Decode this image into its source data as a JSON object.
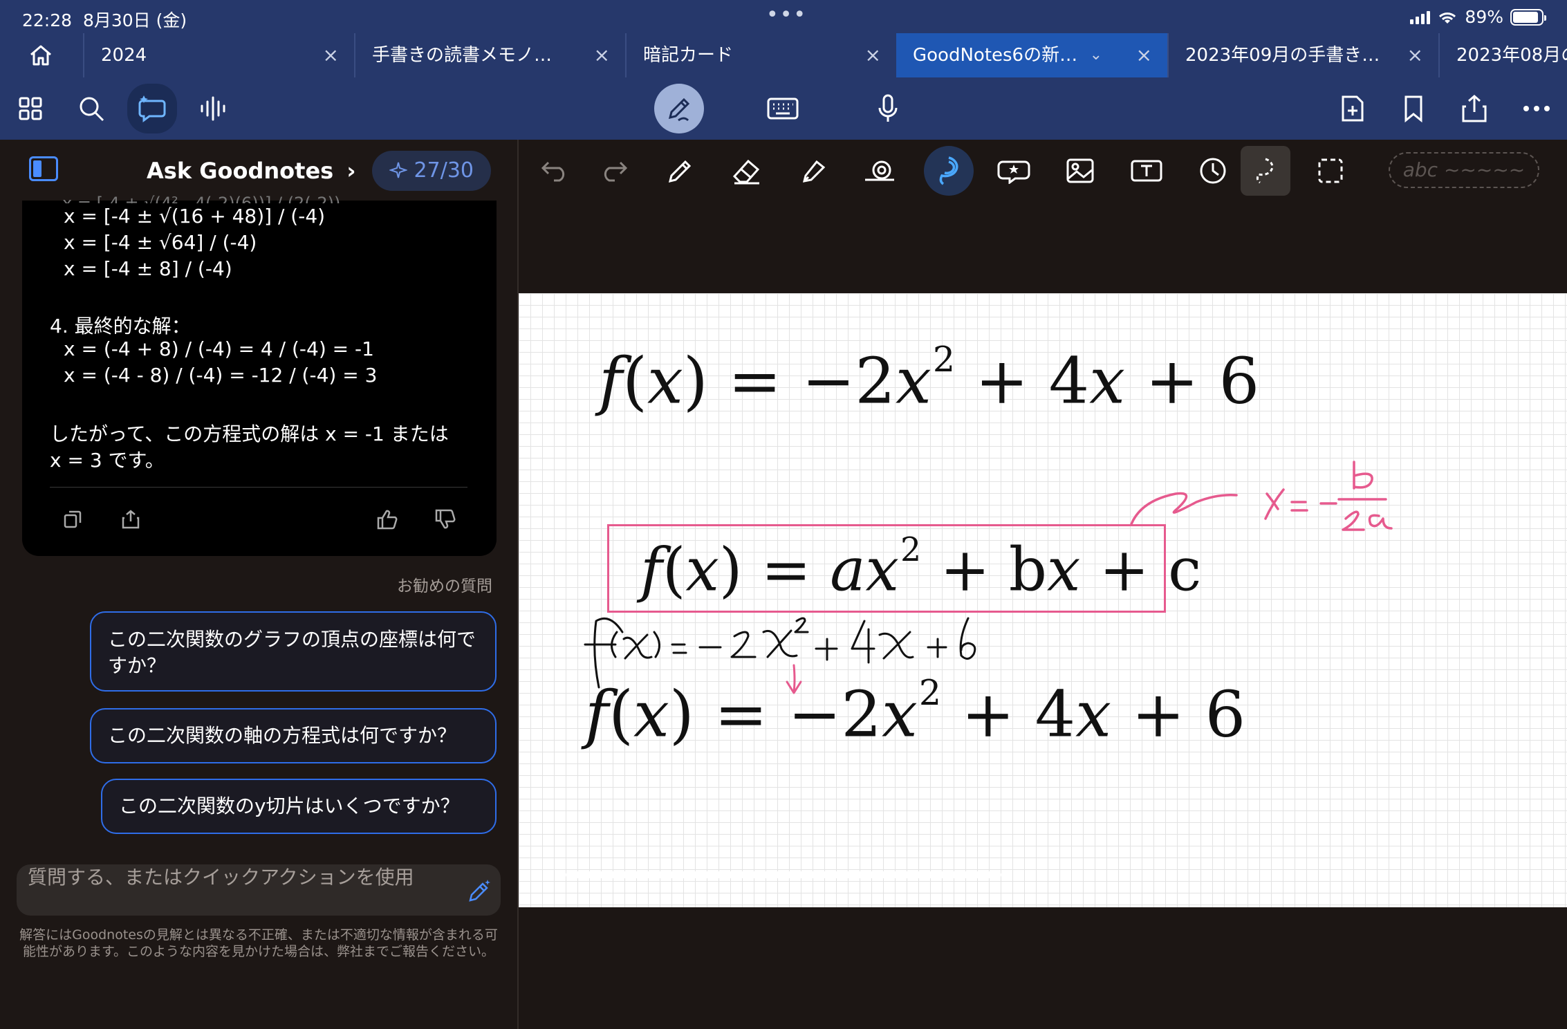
{
  "status_bar": {
    "time": "22:28",
    "date": "8月30日 (金)",
    "dots": "•••",
    "battery": "89%",
    "battery_level": 0.89
  },
  "tabs": [
    {
      "label": "2024",
      "close": "×"
    },
    {
      "label": "手書きの読書メモノ…",
      "close": "×"
    },
    {
      "label": "暗記カード",
      "close": "×"
    },
    {
      "label": "GoodNotes6の新…",
      "close": "×",
      "active": true
    },
    {
      "label": "2023年09月の手書き…",
      "close": "×"
    },
    {
      "label": "2023年08月の",
      "close": ""
    }
  ],
  "toolbar": {
    "left": [
      "grid-icon",
      "search-icon",
      "ask-goodnotes-icon",
      "audio-waveform-icon"
    ],
    "center": [
      "pen-mode-icon",
      "keyboard-icon",
      "microphone-icon"
    ],
    "right": [
      "add-page-icon",
      "bookmark-icon",
      "share-icon",
      "more-icon"
    ]
  },
  "sidebar": {
    "title": "Ask Goodnotes",
    "chevron": "›",
    "credits": "27/30",
    "answer_lines": [
      "x = [-4 ± √(16 + 48)] / (-4)",
      "x = [-4 ± √64] / (-4)",
      "x = [-4 ± 8] / (-4)",
      "4. 最終的な解：",
      "x = (-4 + 8) / (-4) = 4 / (-4) = -1",
      "x = (-4 - 8) / (-4) = -12 / (-4) = 3",
      "したがって、この方程式の解は x = -1 または",
      "x = 3 です。"
    ],
    "recommended_label": "お勧めの質問",
    "suggestions": [
      "この二次関数のグラフの頂点の座標は何ですか？",
      "この二次関数の軸の方程式は何ですか？",
      "この二次関数のy切片はいくつですか？"
    ],
    "input_placeholder": "質問する、またはクイックアクションを使用",
    "disclaimer": "解答にはGoodnotesの見解とは異なる不正確、または不適切な情報が含まれる可能性があります。このような内容を見かけた場合は、弊社までご報告ください。"
  },
  "canvas_tools": {
    "items": [
      "undo-icon",
      "redo-icon",
      "pen-icon",
      "eraser-icon",
      "highlighter-icon",
      "shape-icon",
      "lasso-icon",
      "sticker-icon",
      "image-icon",
      "text-box-icon",
      "clock-icon",
      "lasso-select-icon",
      "select-rect-icon"
    ],
    "handwriting_placeholder": "abc ~~~~~"
  },
  "page": {
    "eq1": {
      "lhs": "f",
      "x": "x",
      "rhs_a": "−2",
      "exp": "2",
      "rhs_b": "+ 4",
      "rhs_c": "+ 6"
    },
    "eq2": {
      "lhs": "f",
      "x": "x",
      "a": "a",
      "exp": "2",
      "b": "+ b",
      "c": "+ c"
    },
    "handwritten_eq": "f(x) = -2x² + 4x + 6",
    "handwritten_note": "x = - b/2a",
    "eq3": {
      "lhs": "f",
      "x": "x",
      "rhs_a": "−2",
      "exp": "2",
      "rhs_b": "+ 4",
      "rhs_c": "+ 6"
    },
    "accent_color": "#e65a8e"
  }
}
